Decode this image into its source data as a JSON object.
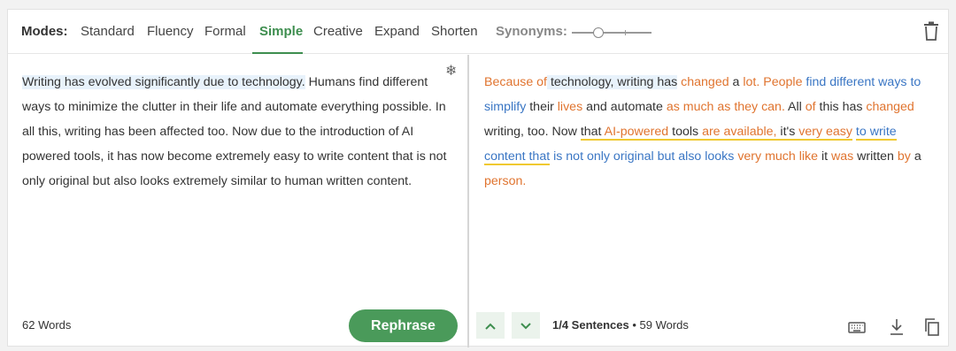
{
  "modes": {
    "label": "Modes:",
    "tabs": [
      {
        "label": "Standard"
      },
      {
        "label": "Fluency"
      },
      {
        "label": "Formal"
      },
      {
        "label": "Simple",
        "active": true
      },
      {
        "label": "Creative"
      },
      {
        "label": "Expand"
      },
      {
        "label": "Shorten"
      }
    ],
    "synonyms_label": "Synonyms:",
    "synonyms_level": 0.25
  },
  "input": {
    "segments": [
      {
        "t": "Writing has evolved significantly due to technology.",
        "hl": true
      },
      {
        "t": " Humans find different ways to minimize the clutter in their life and automate everything possible. In all this, writing has been affected too. Now due to the introduction of AI powered tools, it has now become extremely easy to write content that is not only original but also looks extremely similar to human written content."
      }
    ],
    "word_count": "62 Words",
    "rephrase_label": "Rephrase"
  },
  "output": {
    "segments": [
      {
        "t": "Because of",
        "c": "o"
      },
      {
        "t": " technology, writing has",
        "hl": true
      },
      {
        "t": " "
      },
      {
        "t": "changed",
        "c": "o"
      },
      {
        "t": " a "
      },
      {
        "t": "lot.",
        "c": "o"
      },
      {
        "t": " "
      },
      {
        "t": "People",
        "c": "o"
      },
      {
        "t": " "
      },
      {
        "t": "find different ways to simplify",
        "c": "b"
      },
      {
        "t": " their "
      },
      {
        "t": "lives",
        "c": "o"
      },
      {
        "t": " and automate "
      },
      {
        "t": "as much as they can.",
        "c": "o"
      },
      {
        "t": " All "
      },
      {
        "t": "of",
        "c": "o"
      },
      {
        "t": " this has "
      },
      {
        "t": "changed",
        "c": "o"
      },
      {
        "t": " writing, too. Now "
      },
      {
        "t": "that ",
        "ul": true
      },
      {
        "t": "AI-powered",
        "c": "o",
        "ul": true
      },
      {
        "t": " tools ",
        "ul": true
      },
      {
        "t": "are available,",
        "c": "o",
        "ul": true
      },
      {
        "t": " it's ",
        "ul": true
      },
      {
        "t": "very easy",
        "c": "o",
        "ul": true
      },
      {
        "t": " "
      },
      {
        "t": "to write content that",
        "c": "b",
        "ul": true
      },
      {
        "t": " "
      },
      {
        "t": "is not only original but also looks",
        "c": "b"
      },
      {
        "t": " "
      },
      {
        "t": "very much like",
        "c": "o"
      },
      {
        "t": " it "
      },
      {
        "t": "was",
        "c": "o"
      },
      {
        "t": " written "
      },
      {
        "t": "by",
        "c": "o"
      },
      {
        "t": " a "
      },
      {
        "t": "person.",
        "c": "o"
      }
    ],
    "sentence_position": "1/4 Sentences",
    "word_count": "59 Words"
  },
  "colors": {
    "accent": "#3e8e4f",
    "changed_word": "#e0742f",
    "structural_change": "#3a76c4",
    "longest_unchanged": "#f0c930"
  }
}
